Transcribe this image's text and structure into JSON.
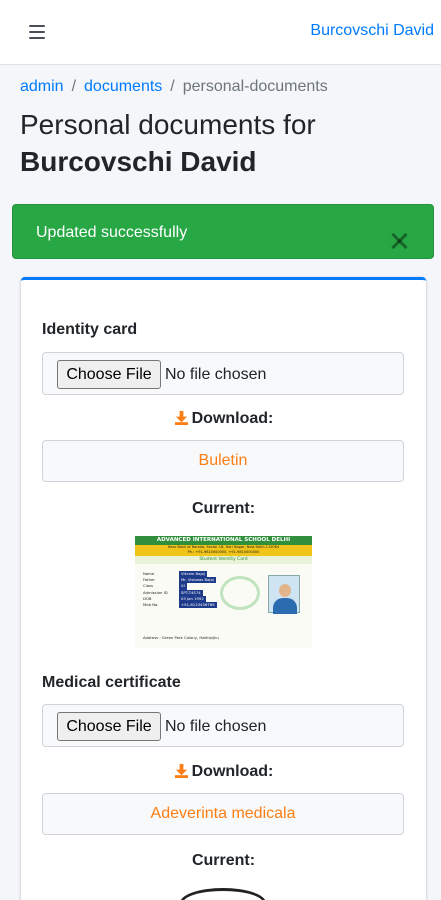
{
  "navbar": {
    "menu_icon": "hamburger-icon",
    "user_name": "Burcovschi David"
  },
  "breadcrumb": {
    "items": [
      {
        "label": "admin"
      },
      {
        "label": "documents"
      },
      {
        "label": "personal-documents"
      }
    ],
    "separator": "/"
  },
  "page": {
    "title_prefix": "Personal documents for",
    "title_name": "Burcovschi David"
  },
  "alert": {
    "message": "Updated successfully",
    "close_icon": "close-icon",
    "color": "#28a745"
  },
  "colors": {
    "primary": "#007bff",
    "download_text": "#fd7e14"
  },
  "documents": [
    {
      "label": "Identity card",
      "choose_label": "Choose File",
      "file_status": "No file chosen",
      "download_label": "Download:",
      "download_icon": "download-icon",
      "download_file": "Buletin",
      "current_label": "Current:",
      "preview": {
        "header": "ADVANCED INTERNATIONAL SCHOOL DELHI",
        "address": "Near Bank of Baroda, Sector 1B, Hari Nagar, New Delhi-110064",
        "phone": "Ph.: +91-9810000000, +91-9810000000",
        "subtitle": "Student Identity Card",
        "rows": [
          {
            "key": "Name",
            "value": "Vikram Bajaj"
          },
          {
            "key": "Father",
            "value": "Mr. Vishwas Bajaj"
          },
          {
            "key": "Class",
            "value": "XI"
          },
          {
            "key": "Admission ID",
            "value": "SPT-T4S74"
          },
          {
            "key": "DOB",
            "value": "03 Jan 1992"
          },
          {
            "key": "Mob No.",
            "value": "+91-8123456789"
          }
        ],
        "address_key": "Address :",
        "address_value": "Green Park Colony, Hathipijhu"
      }
    },
    {
      "label": "Medical certificate",
      "choose_label": "Choose File",
      "file_status": "No file chosen",
      "download_label": "Download:",
      "download_icon": "download-icon",
      "download_file": "Adeverinta medicala",
      "current_label": "Current:"
    }
  ]
}
